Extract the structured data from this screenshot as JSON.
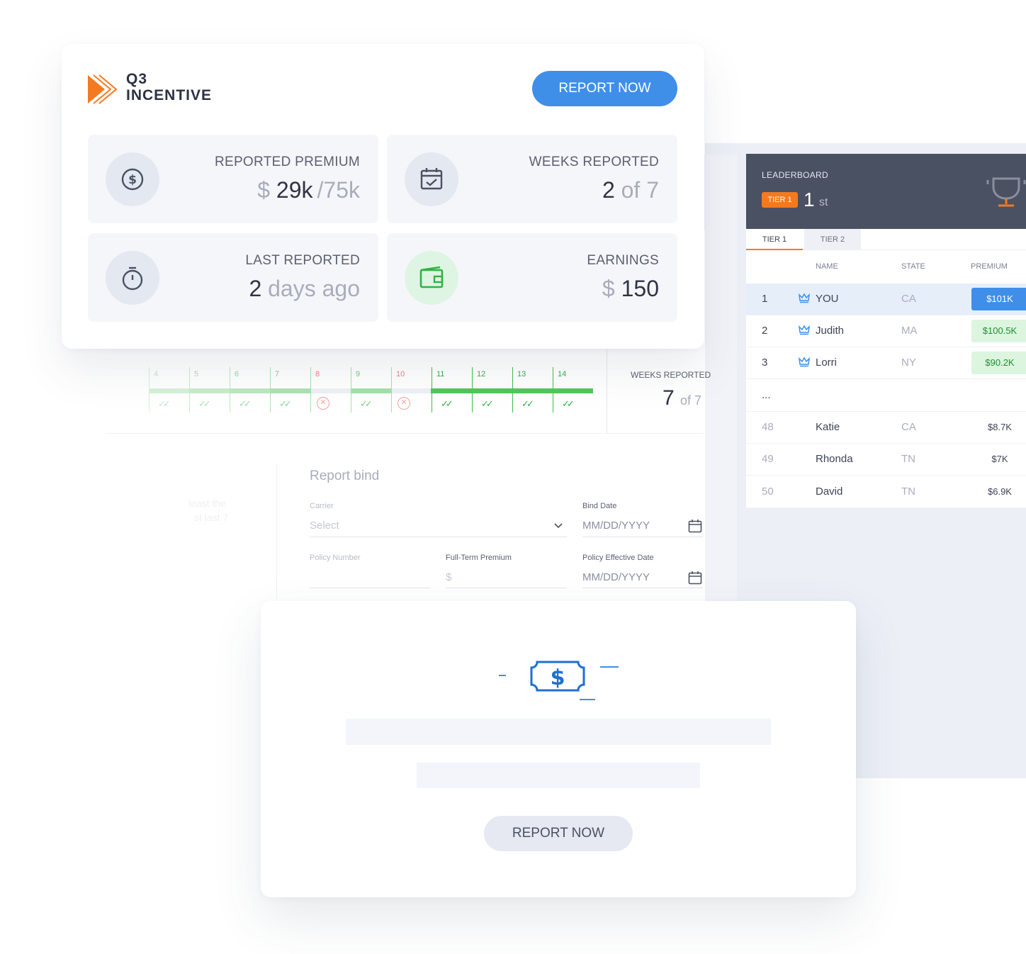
{
  "brand": {
    "title_line1": "Q3",
    "title_line2": "INCENTIVE",
    "report_button": "REPORT NOW"
  },
  "stats": [
    {
      "label": "REPORTED PREMIUM",
      "prefix": "$",
      "value": "29k",
      "suffix": "/75k",
      "icon": "dollar-circle-icon"
    },
    {
      "label": "WEEKS REPORTED",
      "prefix": "",
      "value": "2",
      "suffix": "of 7",
      "icon": "calendar-check-icon"
    },
    {
      "label": "LAST REPORTED",
      "prefix": "",
      "value": "2",
      "suffix": "days ago",
      "icon": "stopwatch-icon"
    },
    {
      "label": "EARNINGS",
      "prefix": "$",
      "value": "150",
      "suffix": "",
      "icon": "wallet-icon"
    }
  ],
  "timeline": {
    "weeks": [
      {
        "num": "4",
        "status": "done"
      },
      {
        "num": "5",
        "status": "done"
      },
      {
        "num": "6",
        "status": "done"
      },
      {
        "num": "7",
        "status": "done"
      },
      {
        "num": "8",
        "status": "missed"
      },
      {
        "num": "9",
        "status": "done"
      },
      {
        "num": "10",
        "status": "missed"
      },
      {
        "num": "11",
        "status": "done"
      },
      {
        "num": "12",
        "status": "done"
      },
      {
        "num": "13",
        "status": "done"
      },
      {
        "num": "14",
        "status": "done"
      }
    ],
    "summary_label": "WEEKS REPORTED",
    "summary_value": "7",
    "summary_suffix": "of 7"
  },
  "form": {
    "title": "Report bind",
    "carrier_label": "Carrier",
    "carrier_placeholder": "Select",
    "bind_date_label": "Bind Date",
    "bind_date_placeholder": "MM/DD/YYYY",
    "policy_number_label": "Policy Number",
    "premium_label": "Full-Term Premium",
    "premium_placeholder": "$",
    "effective_date_label": "Policy Effective Date",
    "effective_date_placeholder": "MM/DD/YYYY",
    "side_hint_1": "least the",
    "side_hint_2": "st last 7"
  },
  "leaderboard": {
    "title": "LEADERBOARD",
    "tier_badge": "TIER 1",
    "rank": "1",
    "rank_suffix": "st",
    "tabs": [
      "TIER 1",
      "TIER 2"
    ],
    "columns": [
      "NAME",
      "STATE",
      "PREMIUM"
    ],
    "rows": [
      {
        "rank": "1",
        "name": "YOU",
        "state": "CA",
        "premium": "$101K",
        "crown": true
      },
      {
        "rank": "2",
        "name": "Judith",
        "state": "MA",
        "premium": "$100.5K",
        "crown": true
      },
      {
        "rank": "3",
        "name": "Lorri",
        "state": "NY",
        "premium": "$90.2K",
        "crown": true
      },
      {
        "rank": "...",
        "name": "",
        "state": "",
        "premium": "",
        "crown": false
      },
      {
        "rank": "48",
        "name": "Katie",
        "state": "CA",
        "premium": "$8.7K",
        "crown": false
      },
      {
        "rank": "49",
        "name": "Rhonda",
        "state": "TN",
        "premium": "$7K",
        "crown": false
      },
      {
        "rank": "50",
        "name": "David",
        "state": "TN",
        "premium": "$6.9K",
        "crown": false
      }
    ]
  },
  "modal": {
    "icon": "money-bill-icon",
    "report_button": "REPORT NOW"
  },
  "colors": {
    "accent_blue": "#3f8fe9",
    "brand_orange": "#f37a21",
    "success_green": "#5cc766",
    "header_dark": "#4a5163"
  }
}
